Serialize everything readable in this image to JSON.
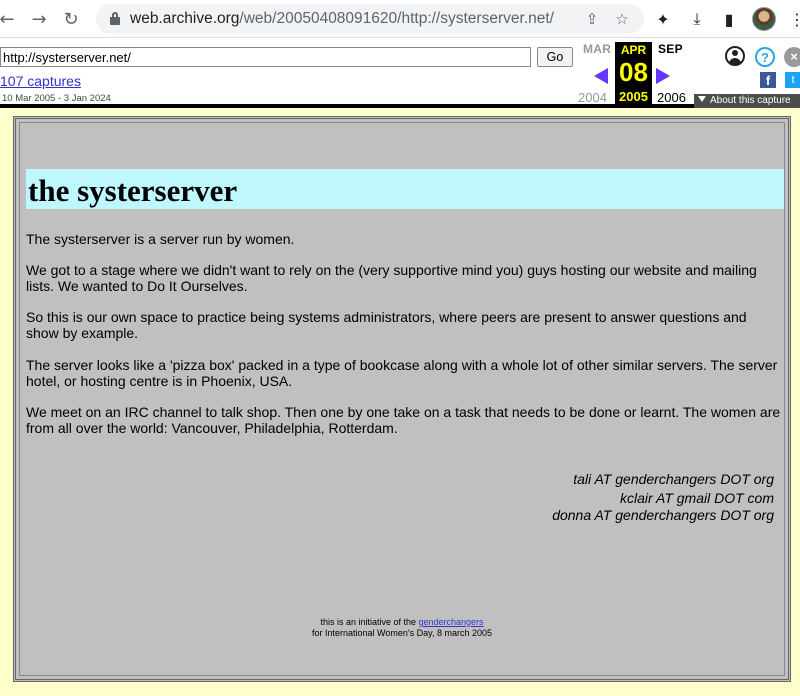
{
  "browser": {
    "url_host": "web.archive.org",
    "url_path": "/web/20050408091620/http://systerserver.net/",
    "icons": [
      "back-arrow-icon",
      "forward-arrow-icon",
      "reload-icon",
      "lock-icon",
      "share-icon",
      "bookmark-star-icon",
      "extensions-puzzle-icon",
      "download-icon",
      "side-panel-icon",
      "profile-avatar",
      "menu-dots-icon"
    ]
  },
  "wayback": {
    "url_value": "http://systerserver.net/",
    "go_label": "Go",
    "captures_label": "107 captures",
    "capture_range": "10 Mar 2005 - 3 Jan 2024",
    "prev_month": "MAR",
    "current_month": "APR",
    "next_month": "SEP",
    "current_day": "08",
    "prev_year": "2004",
    "current_year": "2005",
    "next_year": "2006",
    "about_label": "About this capture",
    "help_glyph": "?",
    "close_glyph": "×",
    "facebook_glyph": "f",
    "twitter_glyph": "t"
  },
  "site": {
    "title": "the systerserver",
    "paragraphs": [
      "The systerserver is a server run by women.",
      "We got to a stage where we didn't want to rely on the (very supportive mind you) guys hosting our website and mailing lists. We wanted to Do It Ourselves.",
      "So this is our own space to practice being systems administrators, where peers are present to answer questions and show by example.",
      "The server looks like a 'pizza box' packed in a type of bookcase along with a whole lot of other similar servers. The server hotel, or hosting centre is in Phoenix, USA.",
      "We meet on an IRC channel to talk shop. Then one by one take on a task that needs to be done or learnt. The women are from all over the world: Vancouver, Philadelphia, Rotterdam."
    ],
    "contacts": [
      "tali AT genderchangers DOT org",
      "kclair AT gmail DOT com",
      "donna AT genderchangers DOT org"
    ],
    "footer_prefix": "this is an initiative of the ",
    "footer_link": "genderchangers",
    "footer_line2": "for International Women's Day, 8 march 2005"
  },
  "colors": {
    "page_bg": "#ffffcc",
    "content_bg": "#c0c0c0",
    "title_band": "#bff7ff",
    "wayback_current": "#ffff00",
    "wayback_arrow": "#6633ff",
    "link": "#3333cc"
  }
}
